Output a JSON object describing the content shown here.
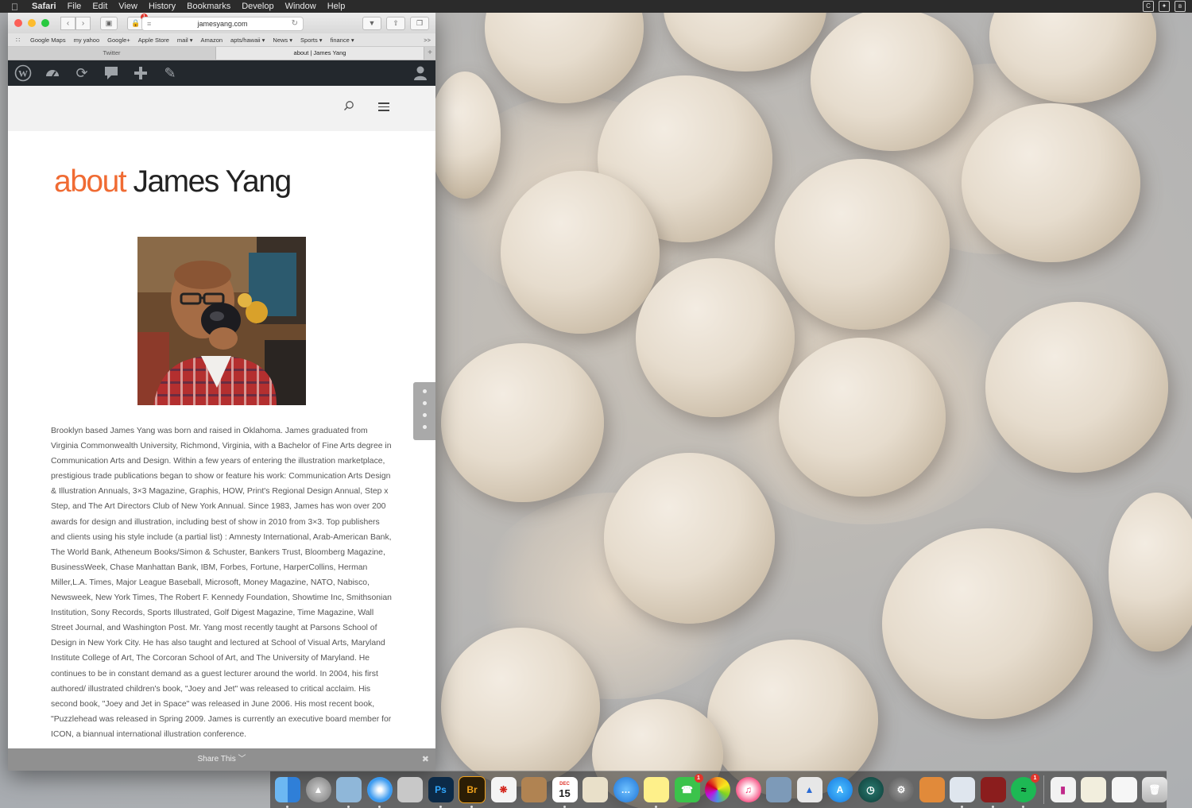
{
  "menubar": {
    "app": "Safari",
    "items": [
      "File",
      "Edit",
      "View",
      "History",
      "Bookmarks",
      "Develop",
      "Window",
      "Help"
    ]
  },
  "browser": {
    "url": "jamesyang.com",
    "bookmarks": [
      "Google Maps",
      "my yahoo",
      "Google+",
      "Apple Store",
      "mail ▾",
      "Amazon",
      "apts/hawaii ▾",
      "News ▾",
      "Sports ▾",
      "finance ▾"
    ],
    "bookmarks_more": ">>",
    "tabs": [
      "Twitter",
      "about | James Yang"
    ],
    "active_tab": 1,
    "notification_badge": "1"
  },
  "page": {
    "title_accent": "about",
    "title_rest": " James Yang",
    "bio": "Brooklyn based James Yang was born and raised in Oklahoma. James graduated from Virginia Commonwealth University, Richmond, Virginia, with a Bachelor of Fine Arts degree in Communication Arts and Design. Within a few years of entering the illustration marketplace, prestigious trade publications began to show or feature his work: Communication Arts Design & Illustration Annuals, 3×3 Magazine, Graphis, HOW, Print's Regional Design Annual, Step x Step, and The Art Directors Club of New York Annual. Since 1983, James has won over 200 awards for design and illustration, including best of show in 2010 from 3×3. Top publishers and clients using his style include (a partial list) : Amnesty International, Arab-American Bank, The World Bank, Atheneum Books/Simon & Schuster, Bankers Trust, Bloomberg Magazine, BusinessWeek, Chase Manhattan Bank, IBM, Forbes, Fortune, HarperCollins, Herman Miller,L.A. Times, Major League Baseball, Microsoft, Money Magazine, NATO, Nabisco, Newsweek, New York Times, The Robert F. Kennedy Foundation, Showtime Inc, Smithsonian Institution, Sony Records, Sports Illustrated, Golf Digest Magazine, Time Magazine, Wall Street Journal, and Washington Post. Mr. Yang most recently taught at Parsons School of Design in New York City. He has also taught and lectured at School of Visual Arts, Maryland Institute College of Art, The Corcoran School of Art, and The University of Maryland. He continues to be in constant demand as a guest lecturer around the world. In 2004, his first authored/ illustrated children's book, \"Joey and Jet\" was released to critical acclaim. His second book, \"Joey and Jet in Space\" was released in June 2006. His most recent book, \"Puzzlehead was released in Spring 2009. James is currently an executive board member for ICON, a biannual international illustration conference.",
    "share_label": "Share This",
    "share_chevron": "﹀"
  },
  "dock": {
    "calendar_month": "DEC",
    "calendar_day": "15",
    "badges": [
      "1",
      "1"
    ]
  },
  "colors": {
    "accent": "#f06b33",
    "wp_admin_bar": "#23282d",
    "menubar": "#2b2b2b"
  }
}
